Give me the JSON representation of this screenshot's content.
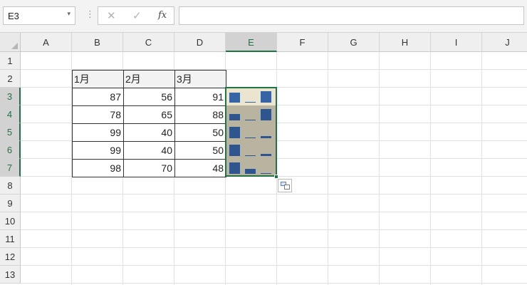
{
  "namebox": {
    "value": "E3",
    "dropdown_icon": "▾"
  },
  "formula_bar": {
    "separator": "⋮",
    "cancel_icon": "✕",
    "enter_icon": "✓",
    "fx_label": "fx",
    "content": ""
  },
  "columns": [
    "A",
    "B",
    "C",
    "D",
    "E",
    "F",
    "G",
    "H",
    "I",
    "J"
  ],
  "rows": [
    "1",
    "2",
    "3",
    "4",
    "5",
    "6",
    "7",
    "8",
    "9",
    "10",
    "11",
    "12",
    "13"
  ],
  "selected_column": "E",
  "selected_rows": [
    "3",
    "4",
    "5",
    "6",
    "7"
  ],
  "table": {
    "headers": [
      "1月",
      "2月",
      "3月"
    ],
    "values": [
      [
        87,
        56,
        91
      ],
      [
        78,
        65,
        88
      ],
      [
        99,
        40,
        50
      ],
      [
        99,
        40,
        50
      ],
      [
        98,
        70,
        48
      ]
    ]
  },
  "sparklines": {
    "type": "column",
    "colors": {
      "bar": "#2f558f",
      "first_row_bar": "#3565a4",
      "first_row_bg": "#ebe5cf",
      "other_bg": "#b9b49f"
    }
  },
  "colors": {
    "accent": "#217346",
    "header_bg": "#efefef",
    "selected_header_bg": "#d2d2d2"
  }
}
